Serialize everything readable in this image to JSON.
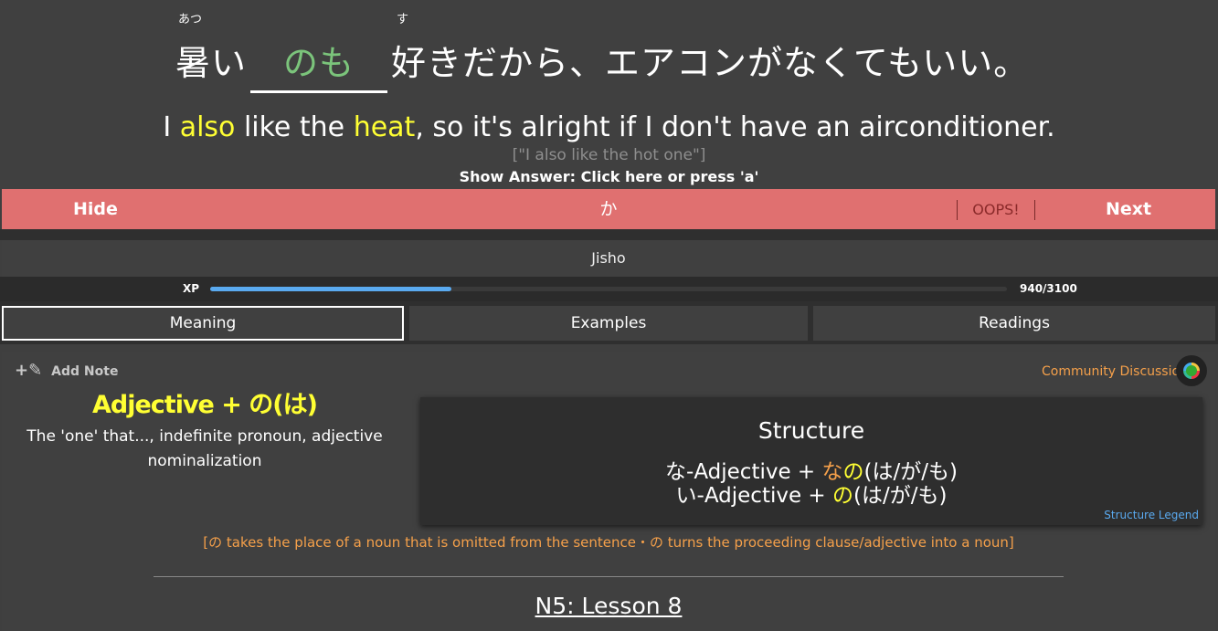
{
  "question": {
    "furigana_1": "あつ",
    "furigana_2": "す",
    "pre_text": "暑い",
    "answer_text": "のも",
    "post_text": "好きだから、エアコンがなくてもいい。",
    "en_1": "I ",
    "en_hl_1": "also",
    "en_2": " like the ",
    "en_hl_2": "heat",
    "en_3": ", so it's alright if I don't have an airconditioner.",
    "hint": "[\"I also like the hot one\"]",
    "show_answer": "Show Answer: Click here or press 'a'"
  },
  "controls": {
    "hide": "Hide",
    "kana": "か",
    "oops": "OOPS!",
    "next": "Next"
  },
  "jisho": "Jisho",
  "xp": {
    "label": "XP",
    "count": "940/3100",
    "progress": 0.303
  },
  "tabs": [
    "Meaning",
    "Examples",
    "Readings"
  ],
  "grammar": {
    "add_note": "Add Note",
    "title": "Adjective + の(は)",
    "meaning": "The 'one' that..., indefinite pronoun, adjective nominalization",
    "community": "Community Discussion",
    "structure_title": "Structure",
    "s1_pre": "な-Adjective + ",
    "s1_na": "な",
    "s1_no": "の",
    "s1_post": "(は/が/も)",
    "s2_pre": "い-Adjective + ",
    "s2_no": "の",
    "s2_post": "(は/が/も)",
    "legend": "Structure Legend",
    "note": "[の takes the place of a noun that is omitted from the sentence・の turns the proceeding clause/adjective into a noun]",
    "lesson": "N5: Lesson 8"
  },
  "colors": {
    "accent_red": "#e07070",
    "highlight_yellow": "#ffff33",
    "orange": "#f5a04a",
    "link_blue": "#5aaaf0",
    "answer_green": "#7bc47b"
  }
}
